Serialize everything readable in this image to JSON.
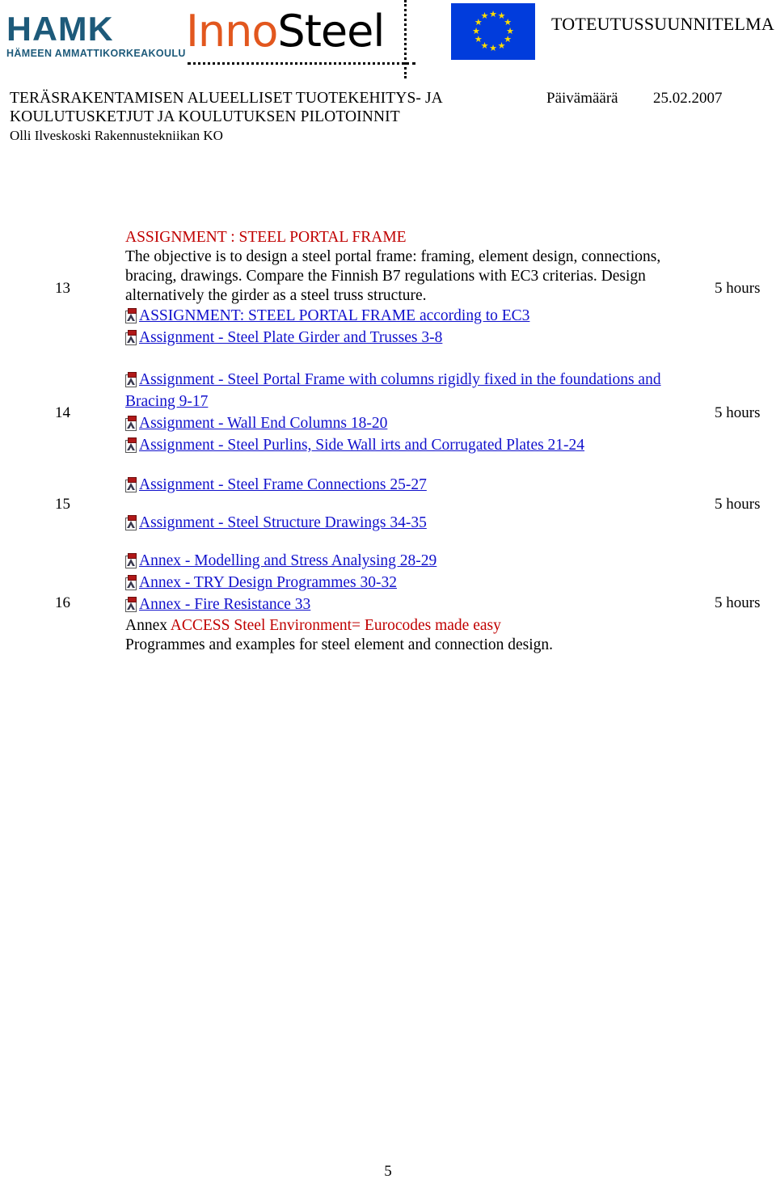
{
  "header": {
    "hamk_logo": {
      "wordmark": "HAMK",
      "tagline": "HÄMEEN AMMATTIKORKEAKOULU",
      "color": "#1d5a7a"
    },
    "innosteel_logo": {
      "part_one": "Inno",
      "part_two": "Steel",
      "part_one_color": "#e2571e",
      "part_two_color": "#000000"
    },
    "eu_flag": {
      "name": "european-union-flag",
      "background_color": "#013cdc",
      "star_color": "#ffdd00",
      "star_count": 12,
      "star_glyph": "★"
    },
    "plan_title": "TOTEUTUSSUUNNITELMA"
  },
  "document": {
    "title_line_1": "TERÄSRAKENTAMISEN ALUEELLISET TUOTEKEHITYS- JA",
    "title_line_2": "KOULUTUSKETJUT JA KOULUTUKSEN PILOTOINNIT",
    "author": "Olli Ilveskoski  Rakennustekniikan KO",
    "date_label": "Päivämäärä",
    "date_value": "25.02.2007",
    "page_number": "5"
  },
  "schedule": {
    "rows": [
      {
        "number": "13",
        "hours": "5 hours",
        "heading": "ASSIGNMENT : STEEL PORTAL FRAME",
        "heading_color": "#c00000",
        "paragraph": "The objective is to design a steel portal frame: framing, element design, connections, bracing, drawings. Compare the Finnish B7 regulations with EC3 criterias. Design alternatively the girder as a steel truss structure.",
        "links": [
          {
            "label": "ASSIGNMENT: STEEL PORTAL FRAME according to EC3",
            "icon": "pdf-icon"
          },
          {
            "label": "Assignment - Steel Plate Girder and Trusses 3-8",
            "icon": "pdf-icon"
          }
        ]
      },
      {
        "number": "14",
        "hours": "5 hours",
        "links": [
          {
            "label": "Assignment - Steel Portal Frame with columns rigidly fixed in the foundations and Bracing 9-17",
            "icon": "pdf-icon",
            "wrap": true
          },
          {
            "label": "Assignment - Wall End Columns 18-20",
            "icon": "pdf-icon"
          },
          {
            "label": "Assignment - Steel Purlins, Side Wall irts and Corrugated Plates 21-24",
            "icon": "pdf-icon"
          }
        ]
      },
      {
        "number": "15",
        "hours": "5 hours",
        "links": [
          {
            "label": "Assignment - Steel Frame Connections 25-27",
            "icon": "pdf-icon"
          },
          {
            "label": "Assignment - Steel Structure Drawings 34-35",
            "icon": "pdf-icon",
            "gap_before": true
          }
        ]
      },
      {
        "number": "16",
        "hours": "5 hours",
        "links": [
          {
            "label": "Annex - Modelling and Stress Analysing 28-29",
            "icon": "pdf-icon"
          },
          {
            "label": "Annex - TRY Design Programmes 30-32",
            "icon": "pdf-icon"
          },
          {
            "label": "Annex - Fire Resistance 33",
            "icon": "pdf-icon"
          }
        ],
        "footer_black_1": "Annex  ",
        "footer_red": "ACCESS Steel  Environment= Eurocodes made easy",
        "footer_black_2": "Programmes and examples for  steel element and connection design."
      }
    ]
  },
  "colors": {
    "link_blue": "#1111cc",
    "accent_red": "#c00000",
    "hamk_blue": "#1d5a7a",
    "innosteel_orange": "#e2571e",
    "eu_blue": "#013cdc",
    "eu_yellow": "#ffdd00"
  }
}
